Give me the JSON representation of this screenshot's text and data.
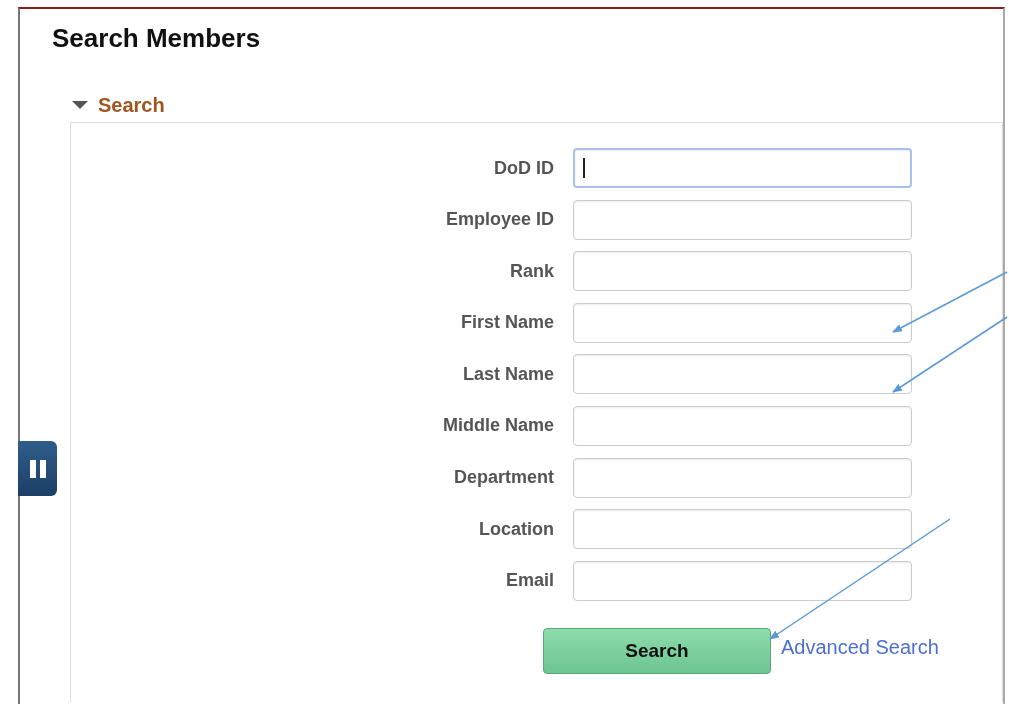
{
  "page": {
    "title": "Search Members"
  },
  "section": {
    "label": "Search",
    "expanded": true
  },
  "fields": [
    {
      "label": "DoD ID",
      "focused": true
    },
    {
      "label": "Employee ID",
      "focused": false
    },
    {
      "label": "Rank",
      "focused": false
    },
    {
      "label": "First Name",
      "focused": false
    },
    {
      "label": "Last Name",
      "focused": false
    },
    {
      "label": "Middle Name",
      "focused": false
    },
    {
      "label": "Department",
      "focused": false
    },
    {
      "label": "Location",
      "focused": false
    },
    {
      "label": "Email",
      "focused": false
    }
  ],
  "search_button": "Search",
  "advanced_link": "Advanced Search"
}
